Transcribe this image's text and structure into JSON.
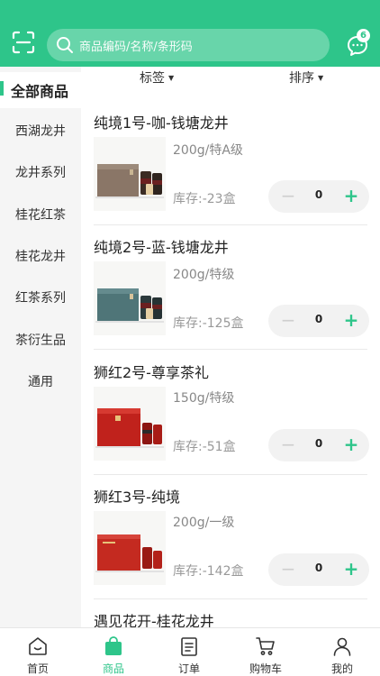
{
  "header": {
    "search_placeholder": "商品编码/名称/条形码",
    "message_count": "6",
    "accent_color": "#2ec58a"
  },
  "filters": {
    "tag_label": "标签",
    "sort_label": "排序"
  },
  "sidebar": {
    "all_label": "全部商品",
    "items": [
      {
        "label": "西湖龙井"
      },
      {
        "label": "龙井系列"
      },
      {
        "label": "桂花红茶"
      },
      {
        "label": "桂花龙井"
      },
      {
        "label": "红茶系列"
      },
      {
        "label": "茶衍生品"
      },
      {
        "label": "通用"
      }
    ]
  },
  "products": [
    {
      "name": "纯境1号-咖-钱塘龙井",
      "spec": "200g/特A级",
      "stock": "库存:-23盒",
      "qty": "0",
      "image_color": "brown"
    },
    {
      "name": "纯境2号-蓝-钱塘龙井",
      "spec": "200g/特级",
      "stock": "库存:-125盒",
      "qty": "0",
      "image_color": "teal"
    },
    {
      "name": "狮红2号-尊享茶礼",
      "spec": "150g/特级",
      "stock": "库存:-51盒",
      "qty": "0",
      "image_color": "red"
    },
    {
      "name": "狮红3号-纯境",
      "spec": "200g/一级",
      "stock": "库存:-142盒",
      "qty": "0",
      "image_color": "red"
    },
    {
      "name": "遇见花开-桂花龙井"
    }
  ],
  "bottom_nav": [
    {
      "label": "首页",
      "icon": "home-icon"
    },
    {
      "label": "商品",
      "icon": "bag-icon"
    },
    {
      "label": "订单",
      "icon": "order-icon"
    },
    {
      "label": "购物车",
      "icon": "cart-icon"
    },
    {
      "label": "我的",
      "icon": "user-icon"
    }
  ]
}
